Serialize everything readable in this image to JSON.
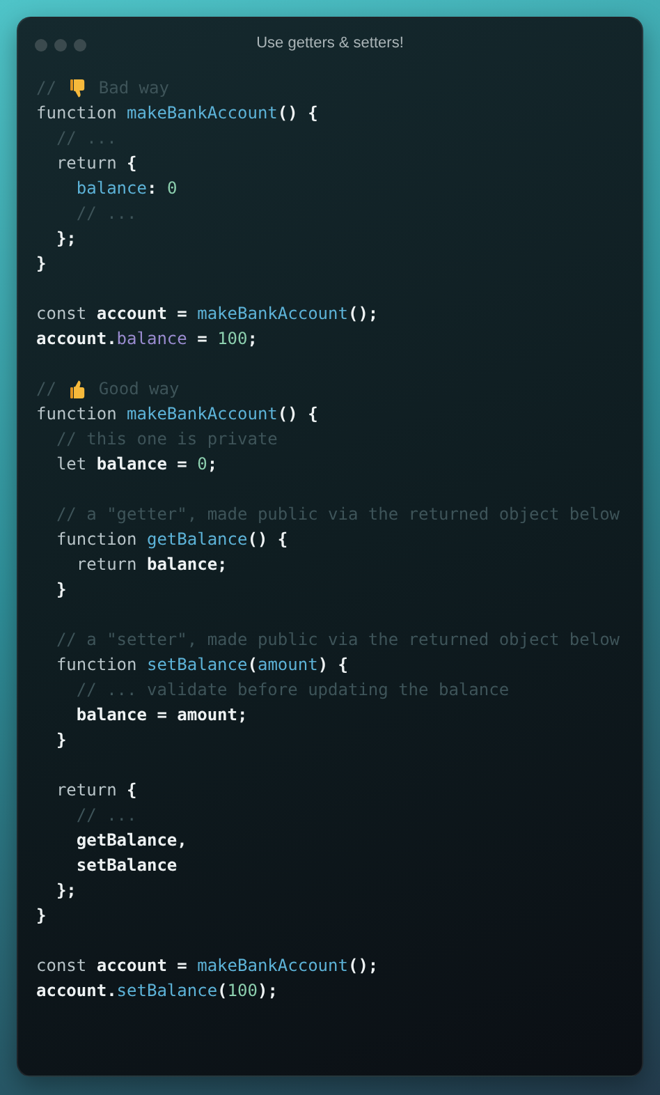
{
  "window": {
    "title": "Use getters & setters!"
  },
  "lines": [
    {
      "kind": "code",
      "tokens": [
        {
          "kind": "comment",
          "text": "// "
        },
        {
          "kind": "thumbs_down"
        },
        {
          "kind": "comment",
          "text": " Bad way"
        }
      ]
    },
    {
      "kind": "code",
      "tokens": [
        {
          "kind": "keyword",
          "text": "function "
        },
        {
          "kind": "func",
          "text": "makeBankAccount"
        },
        {
          "kind": "plain",
          "text": "() {"
        }
      ]
    },
    {
      "kind": "code",
      "tokens": [
        {
          "kind": "comment",
          "text": "  // ..."
        }
      ]
    },
    {
      "kind": "code",
      "tokens": [
        {
          "kind": "keyword",
          "text": "  return "
        },
        {
          "kind": "plain",
          "text": "{"
        }
      ]
    },
    {
      "kind": "code",
      "tokens": [
        {
          "kind": "prop",
          "text": "    balance"
        },
        {
          "kind": "plain",
          "text": ": "
        },
        {
          "kind": "number",
          "text": "0"
        }
      ]
    },
    {
      "kind": "code",
      "tokens": [
        {
          "kind": "comment",
          "text": "    // ..."
        }
      ]
    },
    {
      "kind": "code",
      "tokens": [
        {
          "kind": "plain",
          "text": "  };"
        }
      ]
    },
    {
      "kind": "code",
      "tokens": [
        {
          "kind": "plain",
          "text": "}"
        }
      ]
    },
    {
      "kind": "blank"
    },
    {
      "kind": "code",
      "tokens": [
        {
          "kind": "keyword",
          "text": "const "
        },
        {
          "kind": "plain",
          "text": "account = "
        },
        {
          "kind": "func",
          "text": "makeBankAccount"
        },
        {
          "kind": "plain",
          "text": "();"
        }
      ]
    },
    {
      "kind": "code",
      "tokens": [
        {
          "kind": "plain",
          "text": "account."
        },
        {
          "kind": "member",
          "text": "balance"
        },
        {
          "kind": "plain",
          "text": " = "
        },
        {
          "kind": "number",
          "text": "100"
        },
        {
          "kind": "plain",
          "text": ";"
        }
      ]
    },
    {
      "kind": "blank"
    },
    {
      "kind": "code",
      "tokens": [
        {
          "kind": "comment",
          "text": "// "
        },
        {
          "kind": "thumbs_up"
        },
        {
          "kind": "comment",
          "text": " Good way"
        }
      ]
    },
    {
      "kind": "code",
      "tokens": [
        {
          "kind": "keyword",
          "text": "function "
        },
        {
          "kind": "func",
          "text": "makeBankAccount"
        },
        {
          "kind": "plain",
          "text": "() {"
        }
      ]
    },
    {
      "kind": "code",
      "tokens": [
        {
          "kind": "comment",
          "text": "  // this one is private"
        }
      ]
    },
    {
      "kind": "code",
      "tokens": [
        {
          "kind": "keyword",
          "text": "  let "
        },
        {
          "kind": "plain",
          "text": "balance = "
        },
        {
          "kind": "number",
          "text": "0"
        },
        {
          "kind": "plain",
          "text": ";"
        }
      ]
    },
    {
      "kind": "blank"
    },
    {
      "kind": "code",
      "tokens": [
        {
          "kind": "comment",
          "text": "  // a \"getter\", made public via the returned object below"
        }
      ]
    },
    {
      "kind": "code",
      "tokens": [
        {
          "kind": "keyword",
          "text": "  function "
        },
        {
          "kind": "func",
          "text": "getBalance"
        },
        {
          "kind": "plain",
          "text": "() {"
        }
      ]
    },
    {
      "kind": "code",
      "tokens": [
        {
          "kind": "keyword",
          "text": "    return "
        },
        {
          "kind": "plain",
          "text": "balance;"
        }
      ]
    },
    {
      "kind": "code",
      "tokens": [
        {
          "kind": "plain",
          "text": "  }"
        }
      ]
    },
    {
      "kind": "blank"
    },
    {
      "kind": "code",
      "tokens": [
        {
          "kind": "comment",
          "text": "  // a \"setter\", made public via the returned object below"
        }
      ]
    },
    {
      "kind": "code",
      "tokens": [
        {
          "kind": "keyword",
          "text": "  function "
        },
        {
          "kind": "func",
          "text": "setBalance"
        },
        {
          "kind": "plain",
          "text": "("
        },
        {
          "kind": "param",
          "text": "amount"
        },
        {
          "kind": "plain",
          "text": ") {"
        }
      ]
    },
    {
      "kind": "code",
      "tokens": [
        {
          "kind": "comment",
          "text": "    // ... validate before updating the balance"
        }
      ]
    },
    {
      "kind": "code",
      "tokens": [
        {
          "kind": "plain",
          "text": "    balance = amount;"
        }
      ]
    },
    {
      "kind": "code",
      "tokens": [
        {
          "kind": "plain",
          "text": "  }"
        }
      ]
    },
    {
      "kind": "blank"
    },
    {
      "kind": "code",
      "tokens": [
        {
          "kind": "keyword",
          "text": "  return "
        },
        {
          "kind": "plain",
          "text": "{"
        }
      ]
    },
    {
      "kind": "code",
      "tokens": [
        {
          "kind": "comment",
          "text": "    // ..."
        }
      ]
    },
    {
      "kind": "code",
      "tokens": [
        {
          "kind": "plain",
          "text": "    getBalance,"
        }
      ]
    },
    {
      "kind": "code",
      "tokens": [
        {
          "kind": "plain",
          "text": "    setBalance"
        }
      ]
    },
    {
      "kind": "code",
      "tokens": [
        {
          "kind": "plain",
          "text": "  };"
        }
      ]
    },
    {
      "kind": "code",
      "tokens": [
        {
          "kind": "plain",
          "text": "}"
        }
      ]
    },
    {
      "kind": "blank"
    },
    {
      "kind": "code",
      "tokens": [
        {
          "kind": "keyword",
          "text": "const "
        },
        {
          "kind": "plain",
          "text": "account = "
        },
        {
          "kind": "func",
          "text": "makeBankAccount"
        },
        {
          "kind": "plain",
          "text": "();"
        }
      ]
    },
    {
      "kind": "code",
      "tokens": [
        {
          "kind": "plain",
          "text": "account."
        },
        {
          "kind": "func",
          "text": "setBalance"
        },
        {
          "kind": "plain",
          "text": "("
        },
        {
          "kind": "number",
          "text": "100"
        },
        {
          "kind": "plain",
          "text": ");"
        }
      ]
    }
  ]
}
